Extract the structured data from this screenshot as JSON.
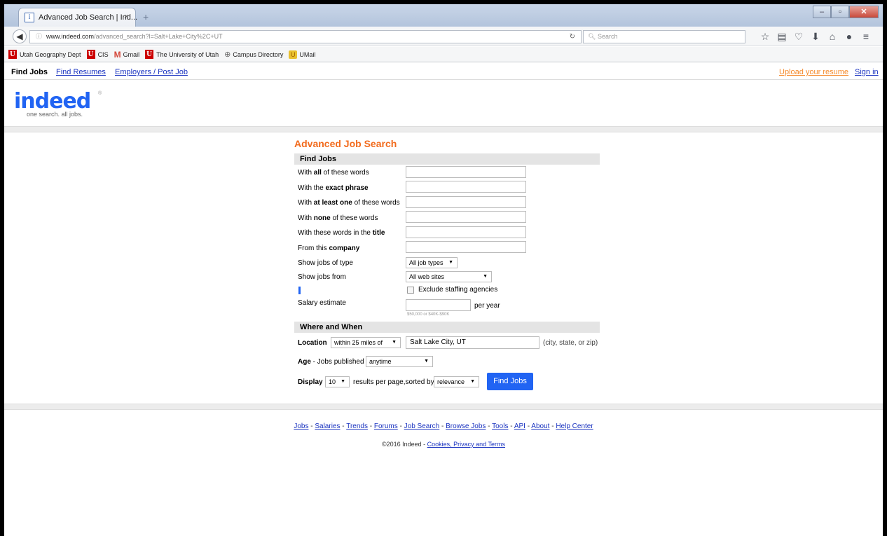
{
  "browser": {
    "tab_title": "Advanced Job Search | Ind...",
    "tab_close": "×",
    "new_tab": "+",
    "url_host": "www.indeed.com",
    "url_path": "/advanced_search?l=Salt+Lake+City%2C+UT",
    "search_placeholder": "Search"
  },
  "bookmarks": [
    {
      "label": "Utah Geography Dept",
      "icon": "u-icon"
    },
    {
      "label": "CIS",
      "icon": "u-icon"
    },
    {
      "label": "Gmail",
      "icon": "gmail-icon"
    },
    {
      "label": "The University of Utah",
      "icon": "u-icon"
    },
    {
      "label": "Campus Directory",
      "icon": "globe-icon"
    },
    {
      "label": "UMail",
      "icon": "umail-icon"
    }
  ],
  "site_nav": {
    "find_jobs": "Find Jobs",
    "find_resumes": "Find Resumes",
    "employers": "Employers / Post Job",
    "upload_resume": "Upload your resume",
    "sign_in": "Sign in"
  },
  "logo": {
    "word": "indeed",
    "tagline": "one search. all jobs.",
    "reg": "®"
  },
  "form": {
    "title": "Advanced Job Search",
    "section_find": "Find Jobs",
    "all_words": {
      "pre": "With ",
      "bold": "all",
      "post": " of these words"
    },
    "exact_phrase": {
      "pre": "With the ",
      "bold": "exact phrase",
      "post": ""
    },
    "at_least_one": {
      "pre": "With ",
      "bold": "at least one",
      "post": " of these words"
    },
    "none_words": {
      "pre": "With ",
      "bold": "none",
      "post": " of these words"
    },
    "title_words": {
      "pre": "With these words in the ",
      "bold": "title",
      "post": ""
    },
    "company": {
      "pre": "From this ",
      "bold": "company",
      "post": ""
    },
    "job_type_label": "Show jobs of type",
    "job_type_value": "All job types",
    "jobs_from_label": "Show jobs from",
    "jobs_from_value": "All web sites",
    "exclude_label": "Exclude staffing agencies",
    "salary_label": "Salary estimate",
    "per_year": "per year",
    "salary_hint": "$50,000 or $40K-$90K",
    "section_where": "Where and When",
    "location_label": "Location",
    "radius_value": "within 25 miles of",
    "location_value": "Salt Lake City, UT",
    "location_hint": "(city, state, or zip)",
    "age_label": "Age",
    "age_suffix": " - Jobs published",
    "age_value": "anytime",
    "display_label": "Display",
    "display_value": "10",
    "results_text": "results per page,sorted by",
    "sort_value": "relevance",
    "find_button": "Find Jobs"
  },
  "footer": {
    "links": [
      "Jobs",
      "Salaries",
      "Trends",
      "Forums",
      "Job Search",
      "Browse Jobs",
      "Tools",
      "API",
      "About",
      "Help Center"
    ],
    "copyright_prefix": "©2016 Indeed - ",
    "copyright_link": "Cookies, Privacy and Terms"
  }
}
